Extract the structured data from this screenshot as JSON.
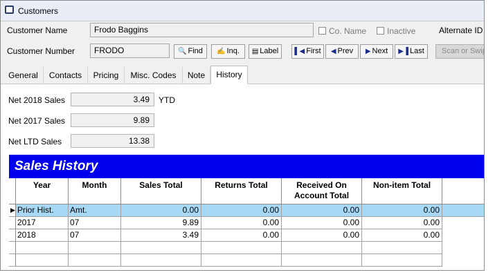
{
  "window": {
    "title": "Customers"
  },
  "fields": {
    "customer_name_label": "Customer Name",
    "customer_name_value": "Frodo Baggins",
    "customer_number_label": "Customer Number",
    "customer_number_value": "FRODO",
    "co_name_label": "Co. Name",
    "inactive_label": "Inactive",
    "alternate_id_label": "Alternate ID"
  },
  "buttons": {
    "find": "Find",
    "inq": "Inq.",
    "label": "Label",
    "first": "First",
    "prev": "Prev",
    "next": "Next",
    "last": "Last",
    "scan": "Scan or Swipe"
  },
  "tabs": [
    "General",
    "Contacts",
    "Pricing",
    "Misc. Codes",
    "Note",
    "History"
  ],
  "active_tab": "History",
  "summary": {
    "net2018_label": "Net 2018 Sales",
    "net2018_value": "3.49",
    "ytd_label": "YTD",
    "net2017_label": "Net 2017 Sales",
    "net2017_value": "9.89",
    "netltd_label": "Net LTD Sales",
    "netltd_value": "13.38"
  },
  "sales_history": {
    "title": "Sales History",
    "columns": [
      "Year",
      "Month",
      "Sales Total",
      "Returns Total",
      "Received On Account Total",
      "Non-item Total"
    ],
    "rows": [
      {
        "year": "Prior Hist.",
        "month": "Amt.",
        "sales": "0.00",
        "returns": "0.00",
        "received": "0.00",
        "nonitem": "0.00"
      },
      {
        "year": "2017",
        "month": "07",
        "sales": "9.89",
        "returns": "0.00",
        "received": "0.00",
        "nonitem": "0.00"
      },
      {
        "year": "2018",
        "month": "07",
        "sales": "3.49",
        "returns": "0.00",
        "received": "0.00",
        "nonitem": "0.00"
      }
    ]
  },
  "icons": {
    "find": "binoculars-icon",
    "inq": "inquiry-icon",
    "label": "label-card-icon",
    "first": "first-record-icon",
    "prev": "previous-record-icon",
    "next": "next-record-icon",
    "last": "last-record-icon"
  },
  "colors": {
    "banner": "#0000ee",
    "selected_row": "#a7d8f5"
  }
}
